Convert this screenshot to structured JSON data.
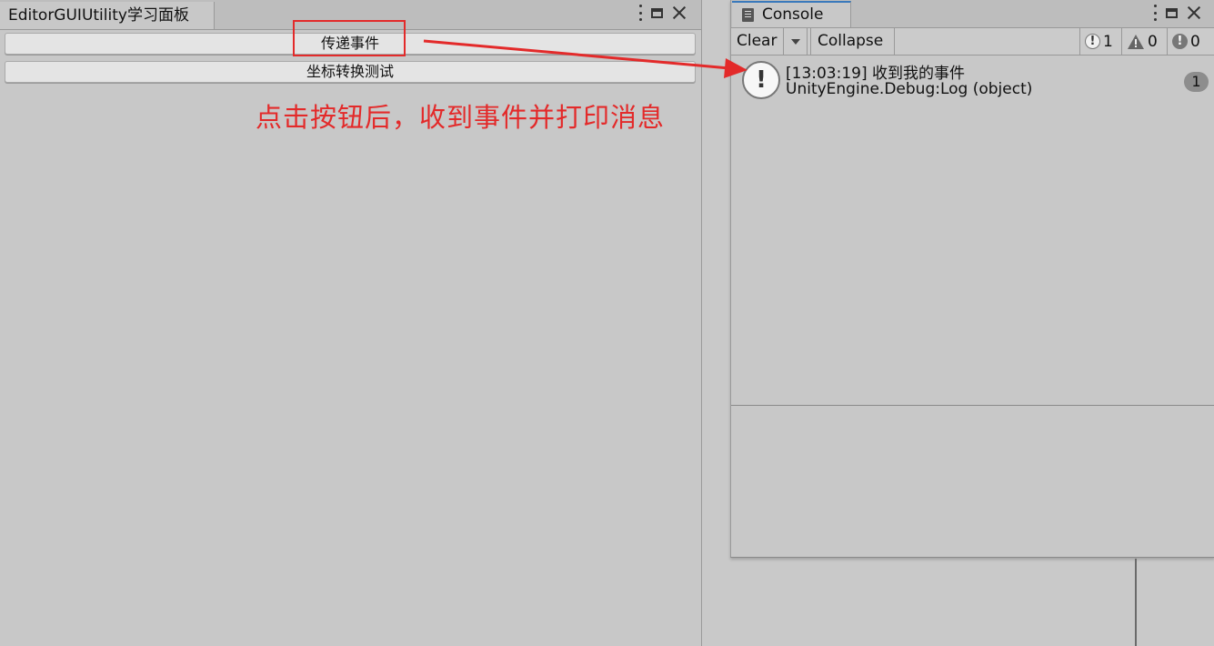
{
  "left_window": {
    "tab_title": "EditorGUIUtility学习面板",
    "buttons": [
      {
        "label": "传递事件"
      },
      {
        "label": "坐标转换测试"
      }
    ],
    "annotation": "点击按钮后，收到事件并打印消息"
  },
  "console": {
    "tab_title": "Console",
    "toolbar": {
      "clear": "Clear",
      "collapse": "Collapse",
      "info_count": "1",
      "warning_count": "0",
      "error_count": "0"
    },
    "log_entry": {
      "line1": "[13:03:19] 收到我的事件",
      "line2": "UnityEngine.Debug:Log (object)",
      "count": "1"
    }
  },
  "colors": {
    "annotation_red": "#e32a2a",
    "tab_accent": "#3a79bb"
  }
}
